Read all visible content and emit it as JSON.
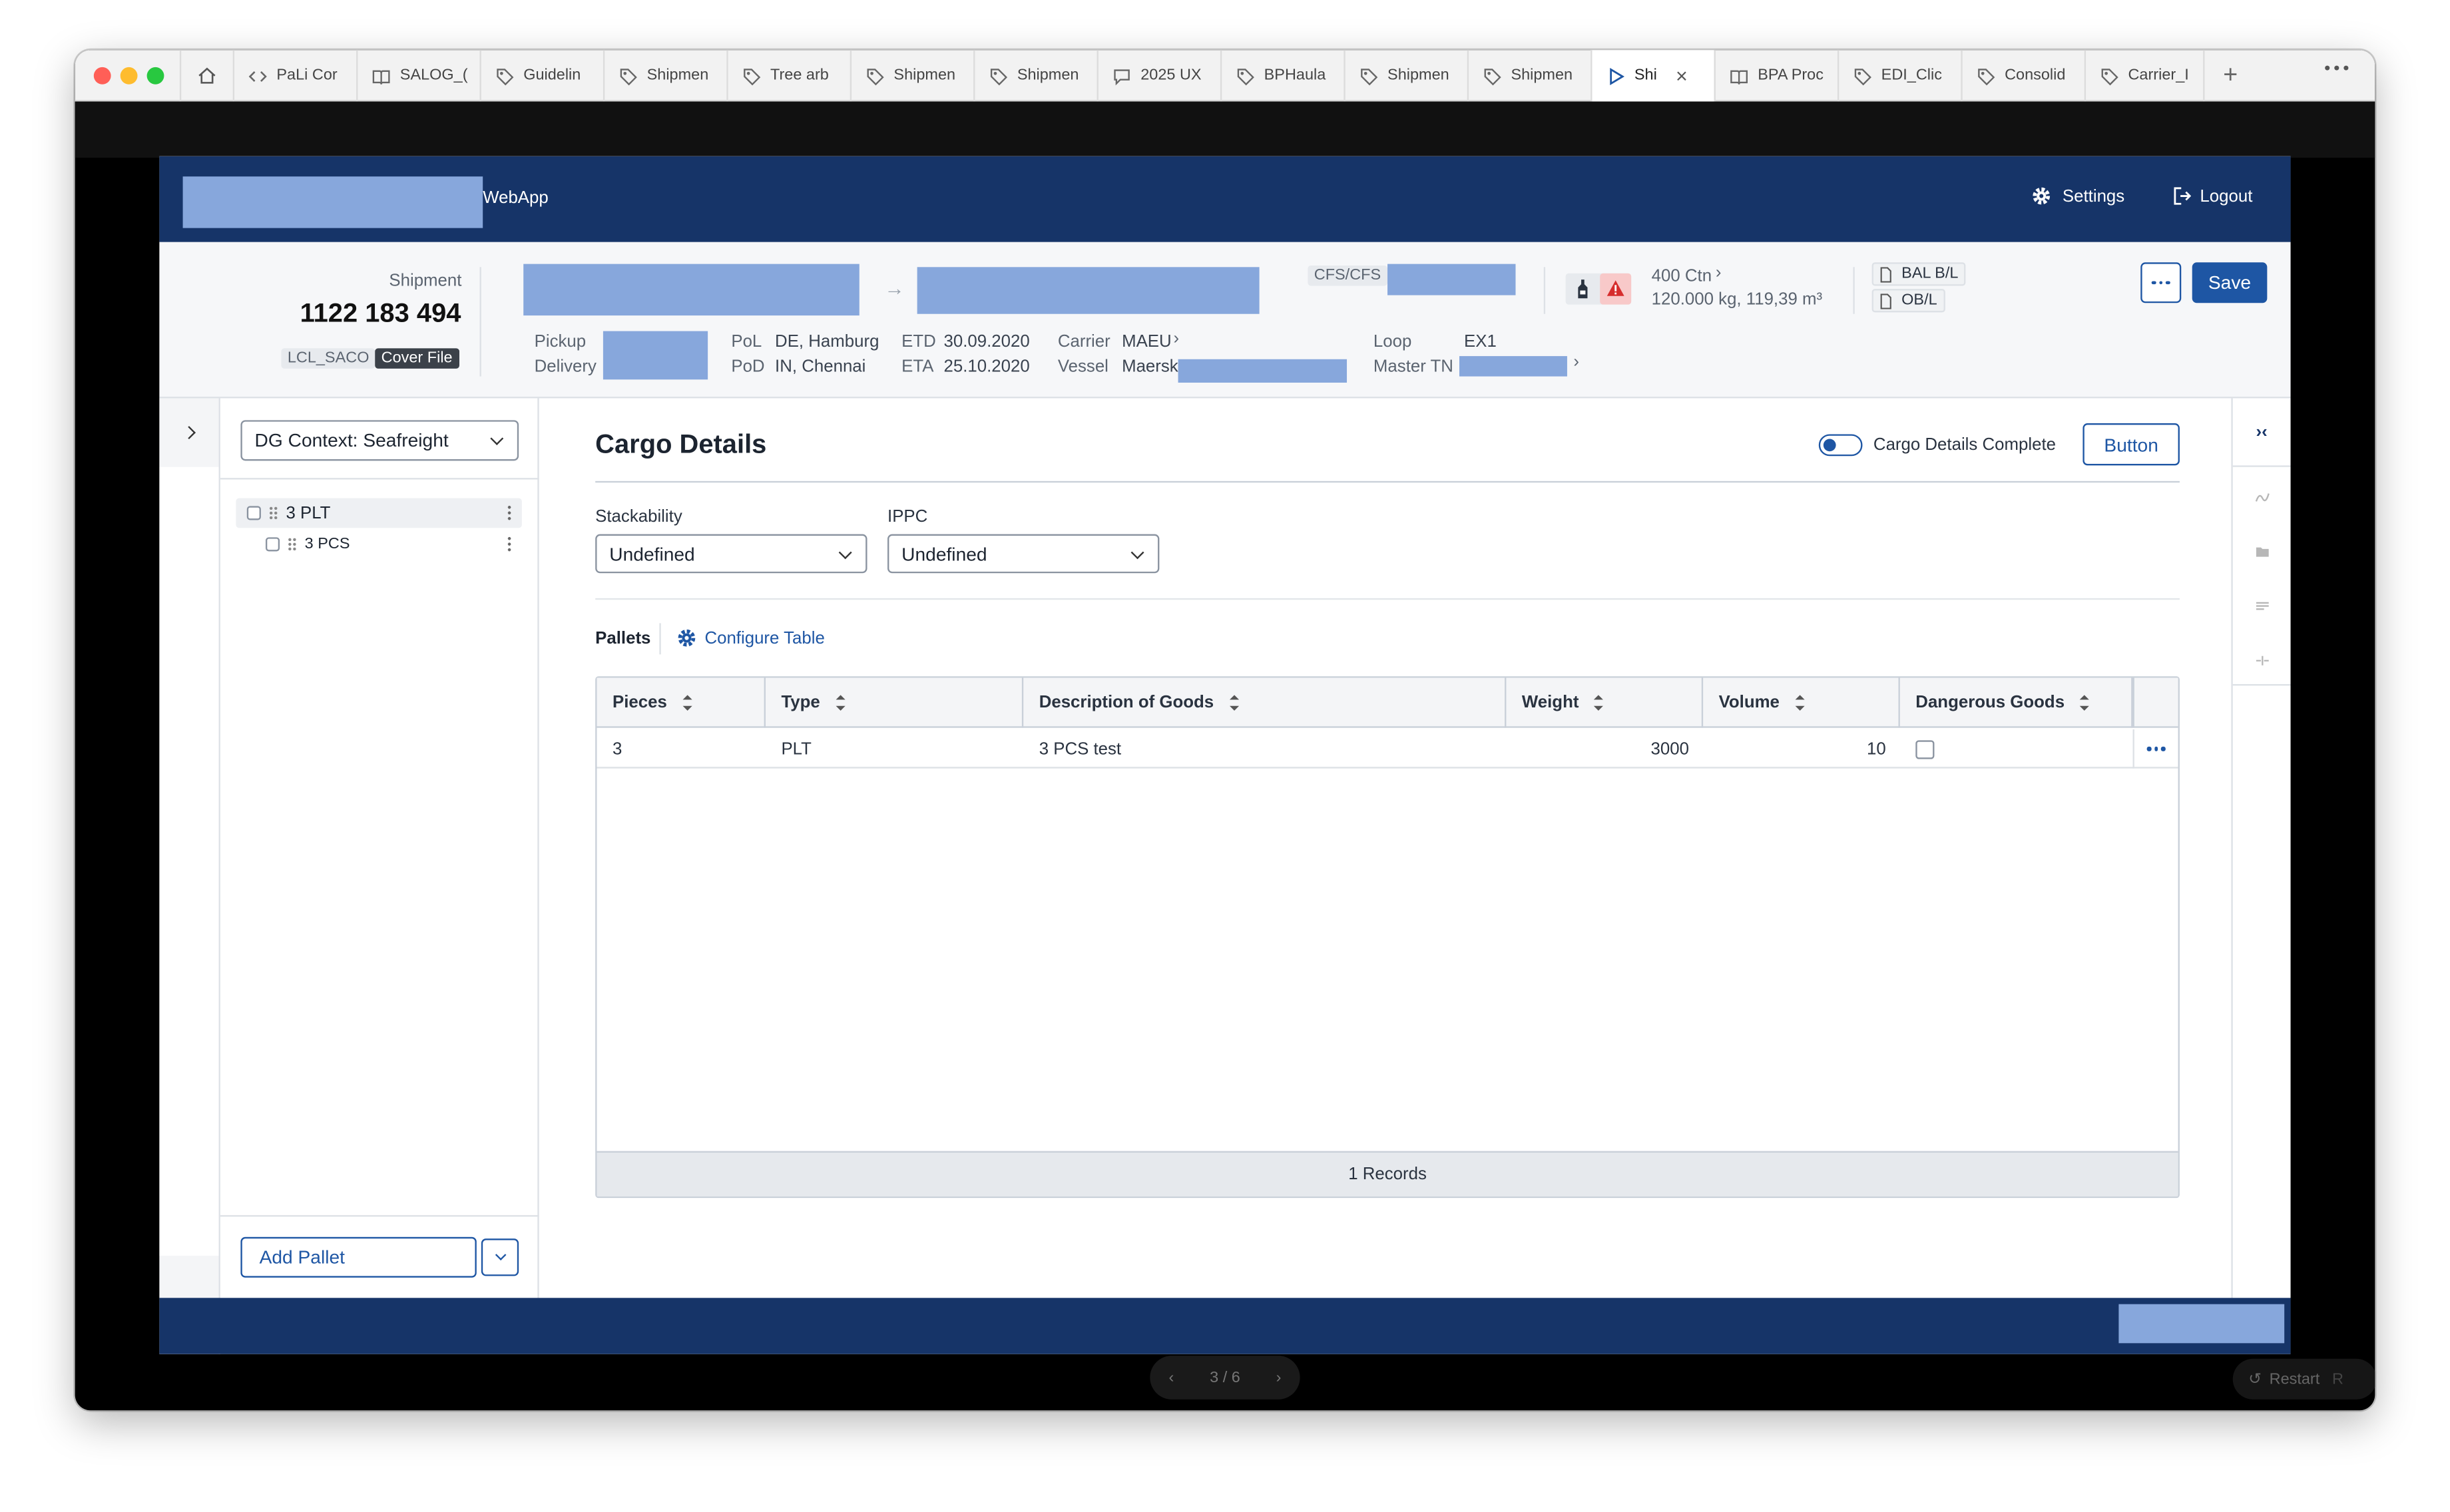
{
  "browser": {
    "tabs": [
      {
        "label": "PaLi Cor",
        "icon": "code-icon"
      },
      {
        "label": "SALOG_(",
        "icon": "book-icon"
      },
      {
        "label": "Guidelin",
        "icon": "tag-icon"
      },
      {
        "label": "Shipmen",
        "icon": "tag-icon"
      },
      {
        "label": "Tree arb",
        "icon": "tag-icon"
      },
      {
        "label": "Shipmen",
        "icon": "tag-icon"
      },
      {
        "label": "Shipmen",
        "icon": "tag-icon"
      },
      {
        "label": "2025 UX",
        "icon": "chat-icon"
      },
      {
        "label": "BPHaula",
        "icon": "tag-icon"
      },
      {
        "label": "Shipmen",
        "icon": "tag-icon"
      },
      {
        "label": "Shipmen",
        "icon": "tag-icon"
      },
      {
        "label": "Shi",
        "icon": "play-icon",
        "active": true
      },
      {
        "label": "BPA Proc",
        "icon": "book-icon"
      },
      {
        "label": "EDI_Clic",
        "icon": "tag-icon"
      },
      {
        "label": "Consolid",
        "icon": "tag-icon"
      },
      {
        "label": "Carrier_I",
        "icon": "tag-icon"
      }
    ]
  },
  "header": {
    "app_name": "WebApp",
    "settings_label": "Settings",
    "logout_label": "Logout"
  },
  "shipment": {
    "label": "Shipment",
    "number": "1122 183 494",
    "tag_primary": "LCL_SACO",
    "tag_secondary": "Cover File",
    "pickup_label": "Pickup",
    "delivery_label": "Delivery",
    "pol_label": "PoL",
    "pol_value": "DE, Hamburg",
    "pod_label": "PoD",
    "pod_value": "IN, Chennai",
    "etd_label": "ETD",
    "etd_value": "30.09.2020",
    "eta_label": "ETA",
    "eta_value": "25.10.2020",
    "carrier_label": "Carrier",
    "carrier_value": "MAEU",
    "vessel_label": "Vessel",
    "vessel_value": "Maersk",
    "service_type": "CFS/CFS",
    "loop_label": "Loop",
    "loop_value": "EX1",
    "master_label": "Master TN",
    "cartons": "400 Ctn",
    "weight_volume": "120.000 kg, 119,39 m³",
    "doc1": "BAL B/L",
    "doc2": "OB/L",
    "save_label": "Save"
  },
  "tree": {
    "context_select": "DG Context: Seafreight",
    "items": [
      {
        "label": "3 PLT"
      },
      {
        "label": "3 PCS"
      }
    ],
    "add_button": "Add Pallet"
  },
  "cargo": {
    "title": "Cargo Details",
    "toggle_label": "Cargo Details Complete",
    "button_label": "Button",
    "stackability_label": "Stackability",
    "stackability_value": "Undefined",
    "ippc_label": "IPPC",
    "ippc_value": "Undefined",
    "pallets_label": "Pallets",
    "configure_label": "Configure Table",
    "columns": [
      "Pieces",
      "Type",
      "Description of Goods",
      "Weight",
      "Volume",
      "Dangerous Goods"
    ],
    "rows": [
      {
        "pieces": "3",
        "type": "PLT",
        "description": "3 PCS test",
        "weight": "3000",
        "volume": "10"
      }
    ],
    "records": "1 Records"
  },
  "pager": {
    "label": "3 / 6",
    "restart_label": "Restart",
    "restart_key": "R"
  },
  "colors": {
    "brand": "#163468",
    "accent": "#1e56a4",
    "redacted": "#87a7dc",
    "warning": "#d62d2d"
  }
}
